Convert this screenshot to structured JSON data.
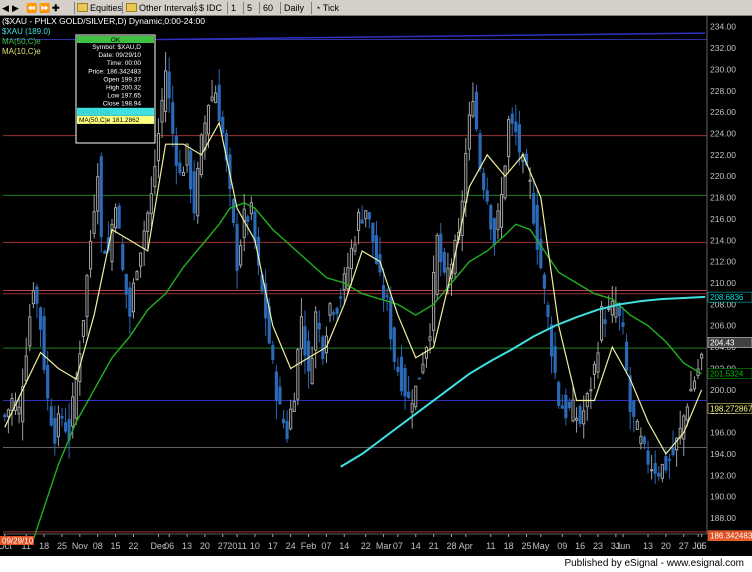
{
  "toolbar": {
    "items": [
      "Equities",
      "Other Intervals",
      "IDC",
      "1",
      "5",
      "60",
      "Daily",
      "Tick"
    ]
  },
  "chart_data": {
    "type": "candlestick",
    "title": "($XAU - PHLX GOLD/SILVER,D) Dynamic,0:00-24:00",
    "legend": {
      "price": "$XAU (189.0)",
      "ma50": "MA(50,C)e",
      "ma10": "MA(10,C)e"
    },
    "ylim": [
      186.5,
      235
    ],
    "y_ticks": [
      188,
      190,
      192,
      194,
      196,
      198,
      200,
      202,
      204,
      206,
      208,
      210,
      212,
      214,
      216,
      218,
      220,
      222,
      224,
      226,
      228,
      230,
      232,
      234
    ],
    "x_ticks": [
      {
        "label": "Oct",
        "bar": 0
      },
      {
        "label": "11",
        "bar": 6
      },
      {
        "label": "18",
        "bar": 11
      },
      {
        "label": "25",
        "bar": 16
      },
      {
        "label": "Nov",
        "bar": 21
      },
      {
        "label": "08",
        "bar": 26
      },
      {
        "label": "15",
        "bar": 31
      },
      {
        "label": "22",
        "bar": 36
      },
      {
        "label": "Dec",
        "bar": 43
      },
      {
        "label": "06",
        "bar": 46
      },
      {
        "label": "13",
        "bar": 51
      },
      {
        "label": "20",
        "bar": 56
      },
      {
        "label": "27",
        "bar": 61
      },
      {
        "label": "2011",
        "bar": 65
      },
      {
        "label": "10",
        "bar": 70
      },
      {
        "label": "17",
        "bar": 75
      },
      {
        "label": "24",
        "bar": 80
      },
      {
        "label": "Feb",
        "bar": 85
      },
      {
        "label": "07",
        "bar": 90
      },
      {
        "label": "14",
        "bar": 95
      },
      {
        "label": "22",
        "bar": 101
      },
      {
        "label": "Mar",
        "bar": 106
      },
      {
        "label": "07",
        "bar": 110
      },
      {
        "label": "14",
        "bar": 115
      },
      {
        "label": "21",
        "bar": 120
      },
      {
        "label": "28",
        "bar": 125
      },
      {
        "label": "Apr",
        "bar": 129
      },
      {
        "label": "11",
        "bar": 136
      },
      {
        "label": "18",
        "bar": 141
      },
      {
        "label": "25",
        "bar": 146
      },
      {
        "label": "May",
        "bar": 150
      },
      {
        "label": "09",
        "bar": 156
      },
      {
        "label": "16",
        "bar": 161
      },
      {
        "label": "23",
        "bar": 166
      },
      {
        "label": "31",
        "bar": 171
      },
      {
        "label": "Jun",
        "bar": 173
      },
      {
        "label": "13",
        "bar": 180
      },
      {
        "label": "20",
        "bar": 185
      },
      {
        "label": "27",
        "bar": 190
      },
      {
        "label": "05",
        "bar": 195
      },
      {
        "label": "Jul",
        "bar": 194
      }
    ],
    "date_marker": "09/29/10",
    "data_window": {
      "header": "OK",
      "rows": [
        "Symbol: $XAU,D",
        "Date: 09/29/10",
        "Time: 00:00",
        "Price: 186.342483",
        "Open 199.37",
        "High 200.32",
        "Low 197.65",
        "Close 198.94",
        "MA(50,C)e",
        "MA(50,C)e 181.2862"
      ]
    },
    "price_labels": [
      {
        "text": "208.6836",
        "value": 208.68,
        "color": "#00e0e0"
      },
      {
        "text": "204.43",
        "value": 204.43,
        "color": "#ffffff"
      },
      {
        "text": "201.5324",
        "value": 201.53,
        "color": "#00c000"
      },
      {
        "text": "198.272867",
        "value": 198.27,
        "color": "#ffff80"
      },
      {
        "text": "186.342483",
        "value": 186.34,
        "color": "#ff8040"
      }
    ],
    "hlines": [
      {
        "value": 232.8,
        "color": "#3030a0"
      },
      {
        "value": 223.8,
        "color": "#a03030"
      },
      {
        "value": 218.2,
        "color": "#208020"
      },
      {
        "value": 213.8,
        "color": "#a03030"
      },
      {
        "value": 209.3,
        "color": "#c04040"
      },
      {
        "value": 209.0,
        "color": "#a03030"
      },
      {
        "value": 203.9,
        "color": "#208020"
      },
      {
        "value": 199.0,
        "color": "#3030c0"
      },
      {
        "value": 194.6,
        "color": "#606060"
      },
      {
        "value": 186.7,
        "color": "#a03030"
      }
    ],
    "trendline": {
      "from": [
        43,
        232.8
      ],
      "to": [
        196,
        233.4
      ],
      "color": "#3030c0"
    },
    "series": {
      "close_path": [
        [
          0,
          197.5
        ],
        [
          2,
          199
        ],
        [
          4,
          198
        ],
        [
          6,
          204
        ],
        [
          8,
          210
        ],
        [
          10,
          206
        ],
        [
          12,
          199
        ],
        [
          14,
          196
        ],
        [
          16,
          197.5
        ],
        [
          18,
          195.8
        ],
        [
          20,
          201
        ],
        [
          22,
          207
        ],
        [
          24,
          214
        ],
        [
          26,
          221
        ],
        [
          27,
          214
        ],
        [
          29,
          213
        ],
        [
          31,
          218
        ],
        [
          33,
          211
        ],
        [
          35,
          207
        ],
        [
          37,
          212
        ],
        [
          39,
          215
        ],
        [
          41,
          218
        ],
        [
          43,
          224
        ],
        [
          45,
          230
        ],
        [
          47,
          224
        ],
        [
          49,
          220
        ],
        [
          51,
          222
        ],
        [
          53,
          217
        ],
        [
          55,
          223
        ],
        [
          57,
          227
        ],
        [
          59,
          228
        ],
        [
          61,
          224
        ],
        [
          63,
          218
        ],
        [
          65,
          212
        ],
        [
          67,
          216
        ],
        [
          69,
          216.5
        ],
        [
          71,
          211
        ],
        [
          73,
          207
        ],
        [
          75,
          202
        ],
        [
          77,
          198
        ],
        [
          79,
          196
        ],
        [
          81,
          200
        ],
        [
          83,
          207
        ],
        [
          85,
          201
        ],
        [
          87,
          207
        ],
        [
          89,
          204
        ],
        [
          91,
          208
        ],
        [
          93,
          208
        ],
        [
          95,
          210
        ],
        [
          97,
          213
        ],
        [
          99,
          216
        ],
        [
          101,
          217
        ],
        [
          103,
          214
        ],
        [
          105,
          210
        ],
        [
          107,
          208
        ],
        [
          109,
          203
        ],
        [
          111,
          201
        ],
        [
          113,
          199
        ],
        [
          115,
          200
        ],
        [
          117,
          203
        ],
        [
          119,
          206
        ],
        [
          121,
          214
        ],
        [
          123,
          210
        ],
        [
          125,
          212
        ],
        [
          127,
          214
        ],
        [
          129,
          222
        ],
        [
          131,
          228
        ],
        [
          133,
          221
        ],
        [
          135,
          218
        ],
        [
          137,
          214
        ],
        [
          139,
          218
        ],
        [
          141,
          225
        ],
        [
          143,
          224
        ],
        [
          145,
          221
        ],
        [
          147,
          219
        ],
        [
          149,
          214
        ],
        [
          151,
          209
        ],
        [
          153,
          204
        ],
        [
          155,
          199
        ],
        [
          157,
          198
        ],
        [
          159,
          198
        ],
        [
          161,
          197
        ],
        [
          163,
          199
        ],
        [
          165,
          202
        ],
        [
          167,
          207
        ],
        [
          169,
          207
        ],
        [
          171,
          208
        ],
        [
          173,
          205
        ],
        [
          175,
          198
        ],
        [
          177,
          196
        ],
        [
          179,
          194
        ],
        [
          181,
          193
        ],
        [
          183,
          192.5
        ],
        [
          185,
          193
        ],
        [
          187,
          194
        ],
        [
          189,
          196
        ],
        [
          191,
          199
        ],
        [
          193,
          201
        ],
        [
          195,
          203
        ]
      ],
      "ma10": [
        [
          0,
          196.5
        ],
        [
          5,
          200
        ],
        [
          10,
          203.5
        ],
        [
          15,
          202
        ],
        [
          20,
          201
        ],
        [
          25,
          207
        ],
        [
          30,
          215
        ],
        [
          35,
          214
        ],
        [
          40,
          213
        ],
        [
          45,
          223
        ],
        [
          50,
          223
        ],
        [
          55,
          222
        ],
        [
          60,
          225
        ],
        [
          65,
          217
        ],
        [
          70,
          214
        ],
        [
          75,
          206
        ],
        [
          80,
          202
        ],
        [
          85,
          203
        ],
        [
          90,
          204
        ],
        [
          95,
          208
        ],
        [
          100,
          213
        ],
        [
          105,
          212
        ],
        [
          110,
          207
        ],
        [
          115,
          203
        ],
        [
          120,
          204
        ],
        [
          125,
          211
        ],
        [
          130,
          219
        ],
        [
          135,
          222
        ],
        [
          140,
          220
        ],
        [
          145,
          222
        ],
        [
          150,
          218
        ],
        [
          155,
          206
        ],
        [
          160,
          199
        ],
        [
          165,
          199
        ],
        [
          170,
          204
        ],
        [
          175,
          201
        ],
        [
          180,
          197
        ],
        [
          185,
          194
        ],
        [
          190,
          196
        ],
        [
          195,
          200
        ]
      ],
      "ma50": [
        [
          8,
          186
        ],
        [
          15,
          193
        ],
        [
          20,
          197
        ],
        [
          25,
          200
        ],
        [
          30,
          203
        ],
        [
          35,
          205
        ],
        [
          40,
          207.5
        ],
        [
          45,
          209
        ],
        [
          50,
          211.5
        ],
        [
          55,
          213.5
        ],
        [
          60,
          215.5
        ],
        [
          63,
          217
        ],
        [
          67,
          217.5
        ],
        [
          70,
          217
        ],
        [
          75,
          215
        ],
        [
          80,
          213.5
        ],
        [
          85,
          212
        ],
        [
          90,
          210.5
        ],
        [
          95,
          210
        ],
        [
          100,
          209
        ],
        [
          105,
          208.5
        ],
        [
          110,
          208
        ],
        [
          115,
          207
        ],
        [
          120,
          208
        ],
        [
          125,
          210
        ],
        [
          130,
          212
        ],
        [
          135,
          213
        ],
        [
          140,
          214.5
        ],
        [
          143,
          215.5
        ],
        [
          147,
          215
        ],
        [
          150,
          213.5
        ],
        [
          155,
          211
        ],
        [
          160,
          210
        ],
        [
          165,
          209
        ],
        [
          170,
          208.5
        ],
        [
          175,
          207
        ],
        [
          180,
          206
        ],
        [
          185,
          204.5
        ],
        [
          190,
          202.5
        ],
        [
          195,
          201.5
        ]
      ],
      "cyan": [
        [
          94,
          192.8
        ],
        [
          100,
          194
        ],
        [
          106,
          195.5
        ],
        [
          112,
          197
        ],
        [
          118,
          198.5
        ],
        [
          124,
          200
        ],
        [
          130,
          201.5
        ],
        [
          136,
          202.7
        ],
        [
          142,
          203.8
        ],
        [
          148,
          205
        ],
        [
          154,
          206
        ],
        [
          160,
          206.8
        ],
        [
          166,
          207.5
        ],
        [
          172,
          208
        ],
        [
          178,
          208.3
        ],
        [
          184,
          208.5
        ],
        [
          190,
          208.6
        ],
        [
          196,
          208.7
        ]
      ]
    }
  }
}
